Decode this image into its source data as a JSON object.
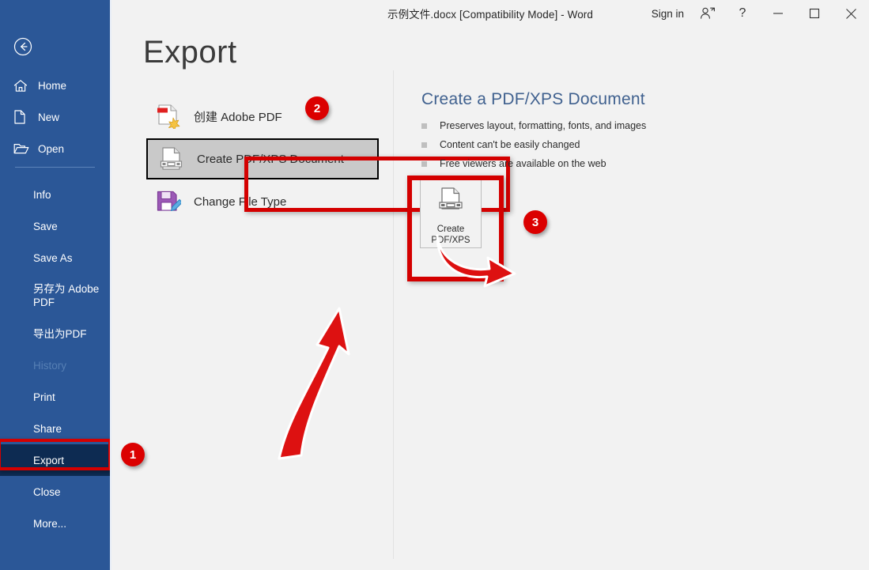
{
  "titlebar": {
    "document_title": "示例文件.docx [Compatibility Mode]  -  Word",
    "sign_in": "Sign in",
    "account_icon": "account-manager-icon",
    "help_icon": "help-question-icon",
    "minimize_icon": "minimize-icon",
    "maximize_icon": "maximize-restore-icon",
    "close_icon": "close-icon"
  },
  "sidebar": {
    "back_icon": "back-arrow-circle-icon",
    "background_color": "#2B5797",
    "selected_color": "#0D2B52",
    "top_items": [
      {
        "label": "Home",
        "icon": "home-icon"
      },
      {
        "label": "New",
        "icon": "new-document-icon"
      },
      {
        "label": "Open",
        "icon": "open-folder-icon"
      }
    ],
    "items": [
      {
        "label": "Info",
        "state": "normal"
      },
      {
        "label": "Save",
        "state": "normal"
      },
      {
        "label": "Save As",
        "state": "normal"
      },
      {
        "label": "另存为 Adobe PDF",
        "state": "normal"
      },
      {
        "label": "导出为PDF",
        "state": "normal"
      },
      {
        "label": "History",
        "state": "disabled"
      },
      {
        "label": "Print",
        "state": "normal"
      },
      {
        "label": "Share",
        "state": "normal"
      },
      {
        "label": "Export",
        "state": "selected"
      },
      {
        "label": "Close",
        "state": "normal"
      },
      {
        "label": "More...",
        "state": "normal"
      }
    ]
  },
  "main": {
    "page_title": "Export",
    "options": [
      {
        "label": "创建 Adobe PDF",
        "icon": "adobe-pdf-icon",
        "state": "normal"
      },
      {
        "label": "Create PDF/XPS Document",
        "icon": "pdf-xps-document-icon",
        "state": "selected"
      },
      {
        "label": "Change File Type",
        "icon": "change-file-type-icon",
        "state": "normal"
      }
    ],
    "detail": {
      "heading": "Create a PDF/XPS Document",
      "heading_color": "#40618F",
      "bullets": [
        "Preserves layout, formatting, fonts, and images",
        "Content can't be easily changed",
        "Free viewers are available on the web"
      ],
      "action_button": {
        "label_line1": "Create",
        "label_line2": "PDF/XPS",
        "icon": "pdf-xps-document-icon"
      }
    }
  },
  "annotations": {
    "highlight_color": "#D40000",
    "badge_color": "#DB0000",
    "badges": [
      {
        "id": "1",
        "target": "sidebar-item-export"
      },
      {
        "id": "2",
        "target": "option-create-pdf-xps-document"
      },
      {
        "id": "3",
        "target": "create-pdf-xps-button"
      }
    ],
    "arrows": [
      {
        "name": "curved-arrow-right",
        "points_to": "create-pdf-xps-button"
      },
      {
        "name": "curved-arrow-up",
        "points_to": "option-create-pdf-xps-document"
      }
    ]
  }
}
